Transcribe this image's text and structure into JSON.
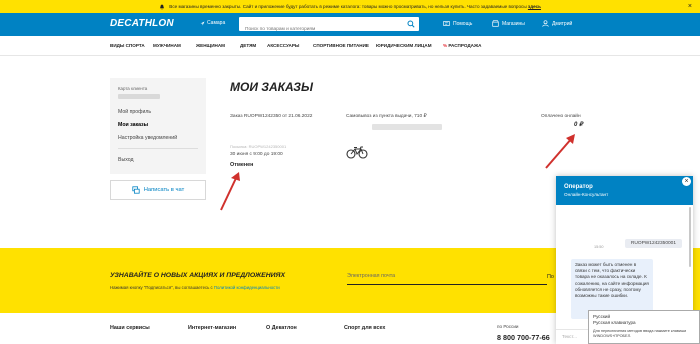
{
  "alert": {
    "text": "Все магазины временно закрыты. Сайт и приложение будут работать в режиме каталога: товары можно просматривать, но нельзя купить. Часто задаваемые вопросы",
    "link": "здесь",
    "close": "×"
  },
  "header": {
    "logo": "DECATHLON",
    "city": "Самара",
    "search_placeholder": "Поиск по товарам и категориям",
    "help": "Помощь",
    "stores": "Магазины",
    "user": "Дмитрий"
  },
  "nav": {
    "items": [
      "ВИДЫ СПОРТА",
      "МУЖЧИНАМ",
      "ЖЕНЩИНАМ",
      "ДЕТЯМ",
      "АКСЕССУАРЫ",
      "СПОРТИВНОЕ ПИТАНИЕ",
      "ЮРИДИЧЕСКИМ ЛИЦАМ",
      "РАСПРОДАЖА"
    ],
    "sale_icon": "%"
  },
  "sidebar": {
    "client_card_label": "Карта клиента",
    "menu": [
      "Мой профиль",
      "Мои заказы",
      "Настройка уведомлений"
    ],
    "logout": "Выход",
    "chat_button": "Написать в чат"
  },
  "orders": {
    "title": "МОИ ЗАКАЗЫ",
    "order_number": "Заказ RUOPW1242350 от 21.06.2022",
    "delivery": "Самовывоз из пункта выдачи, 710 ₽",
    "paid_label": "Оплачено онлайн",
    "paid_sum": "0 ₽",
    "tracking_label": "Посылка: RUOPW1242350001",
    "delivery_date": "30 июня с 9:00 до 19:00",
    "status": "Отменен"
  },
  "promo": {
    "title": "УЗНАВАЙТЕ О НОВЫХ АКЦИЯХ И ПРЕДЛОЖЕНИЯХ",
    "subtitle": "Нажимая кнопку \"Подписаться\", вы соглашаетесь с",
    "policy_link": "Политикой конфиденциальности",
    "email_placeholder": "Электронная почта",
    "button": "По"
  },
  "footer": {
    "col1": "Наши сервисы",
    "col2": "Интернет-магазин",
    "col3": "О Декатлон",
    "col4": "Спорт для всех",
    "phone_label": "по России",
    "phone": "8 800 700-77-66"
  },
  "chat": {
    "operator": "Оператор",
    "role": "Онлайн-Консультант",
    "close": "×",
    "user_message": "RUOPW1242350001",
    "user_time": "15:50",
    "operator_message": "Заказ может быть отменен в связи с тем, что фактически товара не оказалось на складе. К сожалению, на сайте информация обновляется не сразу, поэтому возможны такие ошибки.",
    "operator_time": "15:51",
    "input_placeholder": "Текст..."
  },
  "lang_popup": {
    "lang": "Русский",
    "layout": "Русская клавиатура",
    "hint": "Для переключения методов ввода нажмите клавиши WINDOWS+ПРОБЕЛ."
  },
  "colors": {
    "brand_blue": "#0082c3",
    "yellow": "#ffe100",
    "arrow_red": "#d0312d"
  }
}
